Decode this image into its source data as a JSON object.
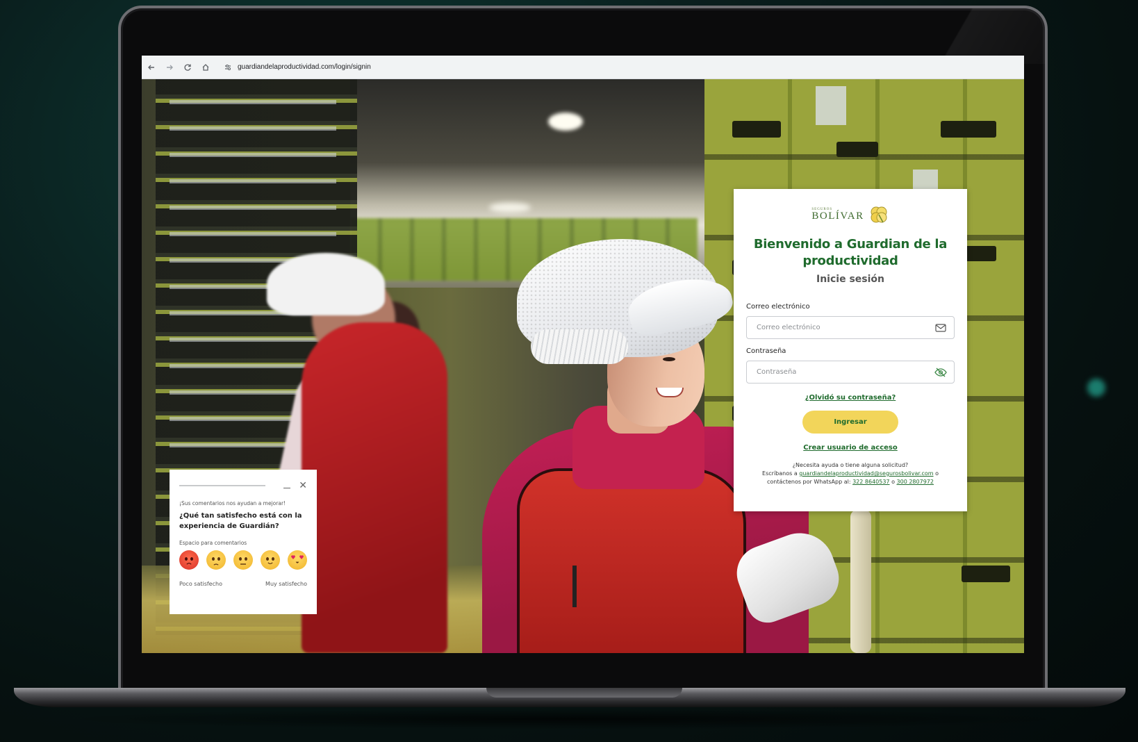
{
  "browser": {
    "url": "guardiandelaproductividad.com/login/signin",
    "back_icon": "arrow-left-icon",
    "forward_icon": "arrow-right-icon",
    "reload_icon": "reload-icon",
    "home_icon": "home-icon",
    "site_info_icon": "tune-icon"
  },
  "login": {
    "logo_small": "SEGUROS",
    "logo_big": "BOLÍVAR",
    "title": "Bienvenido a Guardian de la productividad",
    "subtitle": "Inicie sesión",
    "email_label": "Correo electrónico",
    "email_placeholder": "Correo electrónico",
    "password_label": "Contraseña",
    "password_placeholder": "Contraseña",
    "forgot_link": "¿Olvidó su contraseña?",
    "submit_label": "Ingresar",
    "create_link": "Crear usuario de acceso",
    "help_line1": "¿Necesita ayuda o tiene alguna solicitud?",
    "help_line2_prefix": "Escríbanos a ",
    "help_email": "guardiandelaproductividad@segurosbolivar.com",
    "help_line2_suffix": " o",
    "help_line3_prefix": "contáctenos por WhatsApp al: ",
    "help_phone1": "322 8640537",
    "help_phone_sep": " o ",
    "help_phone2": "300 2807972"
  },
  "feedback": {
    "note": "¡Sus comentarios nos ayudan a mejorar!",
    "question": "¿Qué tan satisfecho está con la experiencia de Guardián?",
    "space_label": "Espacio para comentarios",
    "scale_low": "Poco satisfecho",
    "scale_high": "Muy satisfecho",
    "emojis": [
      "angry-face-icon",
      "frowning-face-icon",
      "neutral-face-icon",
      "slightly-smiling-face-icon",
      "heart-eyes-face-icon"
    ]
  },
  "colors": {
    "brand_green": "#1f6b2d",
    "button_yellow": "#f2d55a"
  }
}
